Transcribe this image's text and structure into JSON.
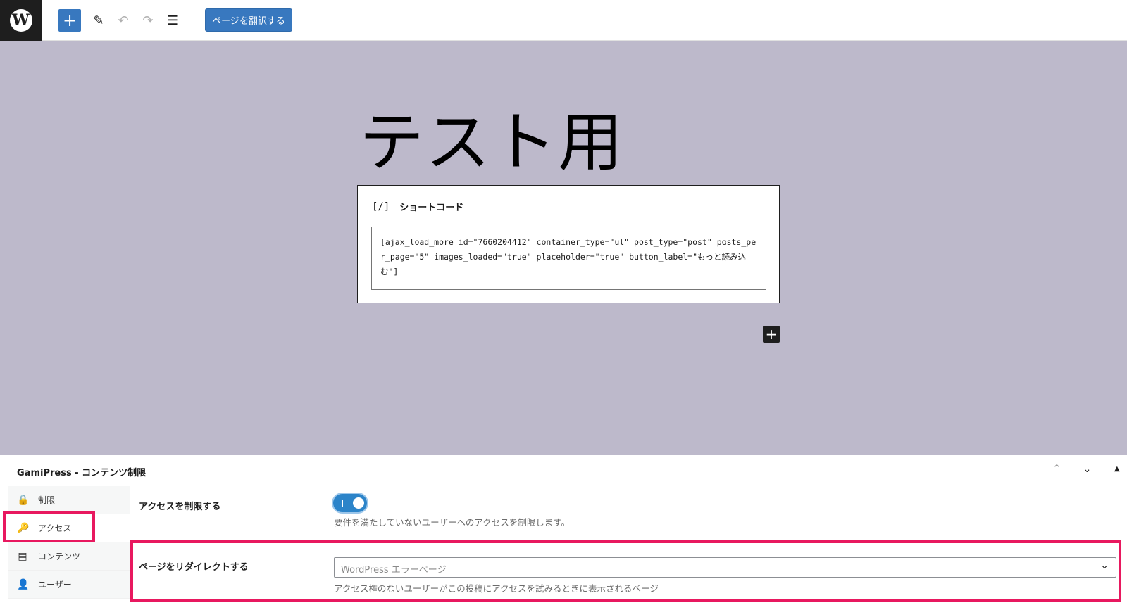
{
  "toolbar": {
    "logo_letter": "W",
    "add_icon": "+",
    "pencil_icon": "✎",
    "undo_icon": "↶",
    "redo_icon": "↷",
    "list_icon": "☰",
    "translate_label": "ページを翻訳する"
  },
  "editor": {
    "title": "テスト用",
    "shortcode_block": {
      "icon": "[/]",
      "label": "ショートコード",
      "content": "[ajax_load_more id=\"7660204412\" container_type=\"ul\" post_type=\"post\" posts_per_page=\"5\" images_loaded=\"true\" placeholder=\"true\" button_label=\"もっと読み込む\"]"
    },
    "inserter_icon": "+"
  },
  "meta_box": {
    "title": "GamiPress - コンテンツ制限",
    "controls": {
      "up": "⌃",
      "down": "⌄",
      "toggle": "▲"
    },
    "tabs": [
      {
        "icon": "🔒",
        "label": "制限"
      },
      {
        "icon": "🔑",
        "label": "アクセス"
      },
      {
        "icon": "▤",
        "label": "コンテンツ"
      },
      {
        "icon": "👤",
        "label": "ユーザー"
      }
    ],
    "restrict_access": {
      "label": "アクセスを制限する",
      "enabled": true,
      "help": "要件を満たしていないユーザーへのアクセスを制限します。"
    },
    "redirect_page": {
      "label": "ページをリダイレクトする",
      "value": "WordPress エラーページ",
      "help": "アクセス権のないユーザーがこの投稿にアクセスを試みるときに表示されるページ"
    }
  },
  "colors": {
    "accent": "#3878bf",
    "canvas_bg": "#bdb9cb",
    "highlight": "#e8185f"
  }
}
